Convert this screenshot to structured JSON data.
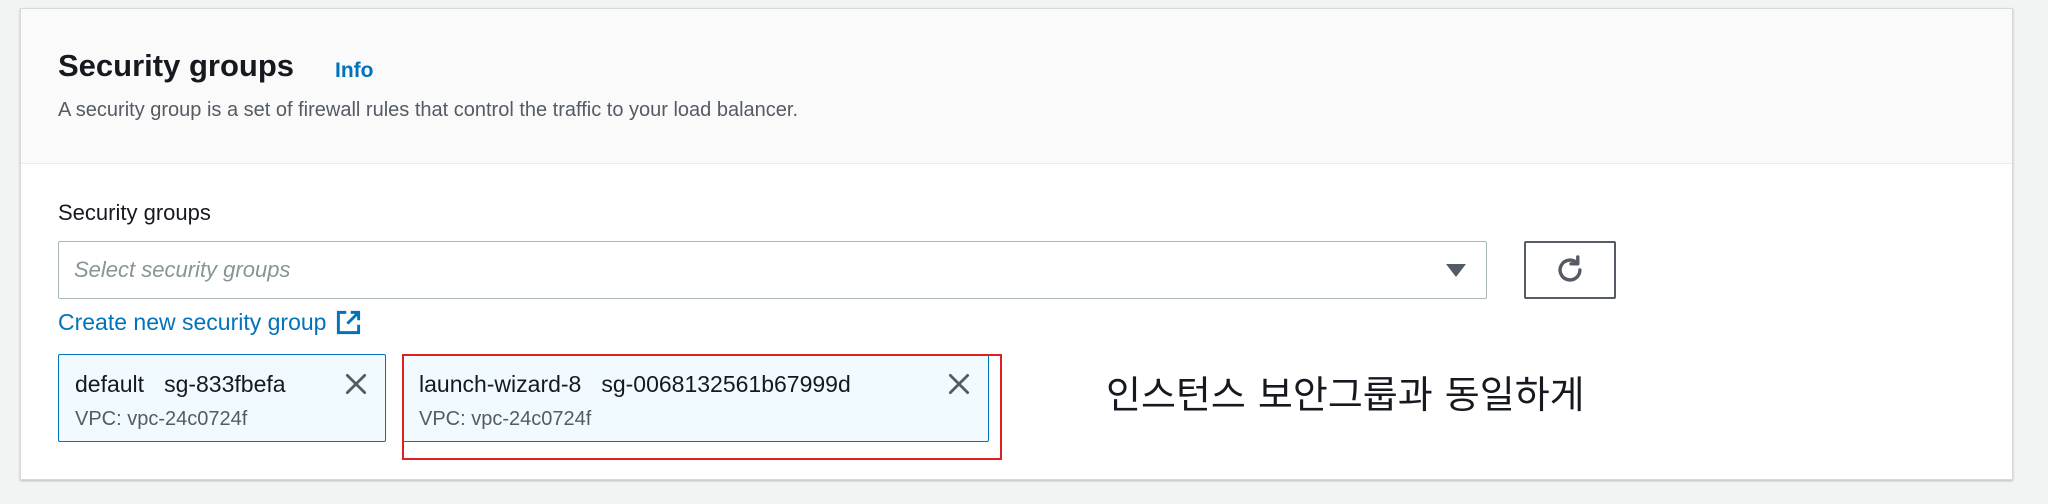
{
  "section": {
    "title": "Security groups",
    "info_link": "Info",
    "description": "A security group is a set of firewall rules that control the traffic to your load balancer."
  },
  "field": {
    "label": "Security groups",
    "placeholder": "Select security groups",
    "create_link": "Create new security group"
  },
  "icons": {
    "dropdown": "caret-down-icon",
    "refresh": "refresh-icon",
    "external_link": "external-link-icon",
    "remove": "close-icon"
  },
  "tokens": [
    {
      "name": "default",
      "id": "sg-833fbefa",
      "vpc": "VPC: vpc-24c0724f"
    },
    {
      "name": "launch-wizard-8",
      "id": "sg-0068132561b67999d",
      "vpc": "VPC: vpc-24c0724f"
    }
  ],
  "annotation": {
    "text": "인스턴스 보안그룹과 동일하게",
    "highlight_color": "#e02020"
  },
  "colors": {
    "link": "#0073bb",
    "token_bg": "#f1faff",
    "token_border": "#0073bb"
  }
}
